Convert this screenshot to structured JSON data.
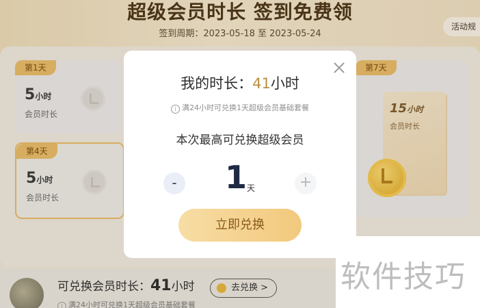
{
  "header": {
    "title": "超级会员时长 签到免费领",
    "period": "签到周期：2023-05-18 至 2023-05-24",
    "rules_label": "活动规"
  },
  "cards": [
    {
      "day": "第1天",
      "hours": "5",
      "unit": "小时",
      "label": "会员时长"
    },
    {
      "day": "第4天",
      "hours": "5",
      "unit": "小时",
      "label": "会员时长"
    },
    {
      "day": "第7天",
      "hours": "15",
      "unit": "小时",
      "label": "会员时长"
    }
  ],
  "bottom": {
    "label": "可兑换会员时长：",
    "hours": "41",
    "unit": "小时",
    "button": "去兑换 >",
    "note": "满24小时可兑换1天超级会员基础套餐"
  },
  "modal": {
    "title_prefix": "我的时长：",
    "hours": "41",
    "unit": "小时",
    "note": "满24小时可兑换1天超级会员基础套餐",
    "subtitle": "本次最高可兑换超级会员",
    "minus": "-",
    "plus": "+",
    "value": "1",
    "value_unit": "天",
    "redeem_button": "立即兑换"
  },
  "watermark": "软件技巧",
  "colors": {
    "accent": "#b8913e",
    "tag": "#e4b867",
    "button": "#f2c97d"
  }
}
